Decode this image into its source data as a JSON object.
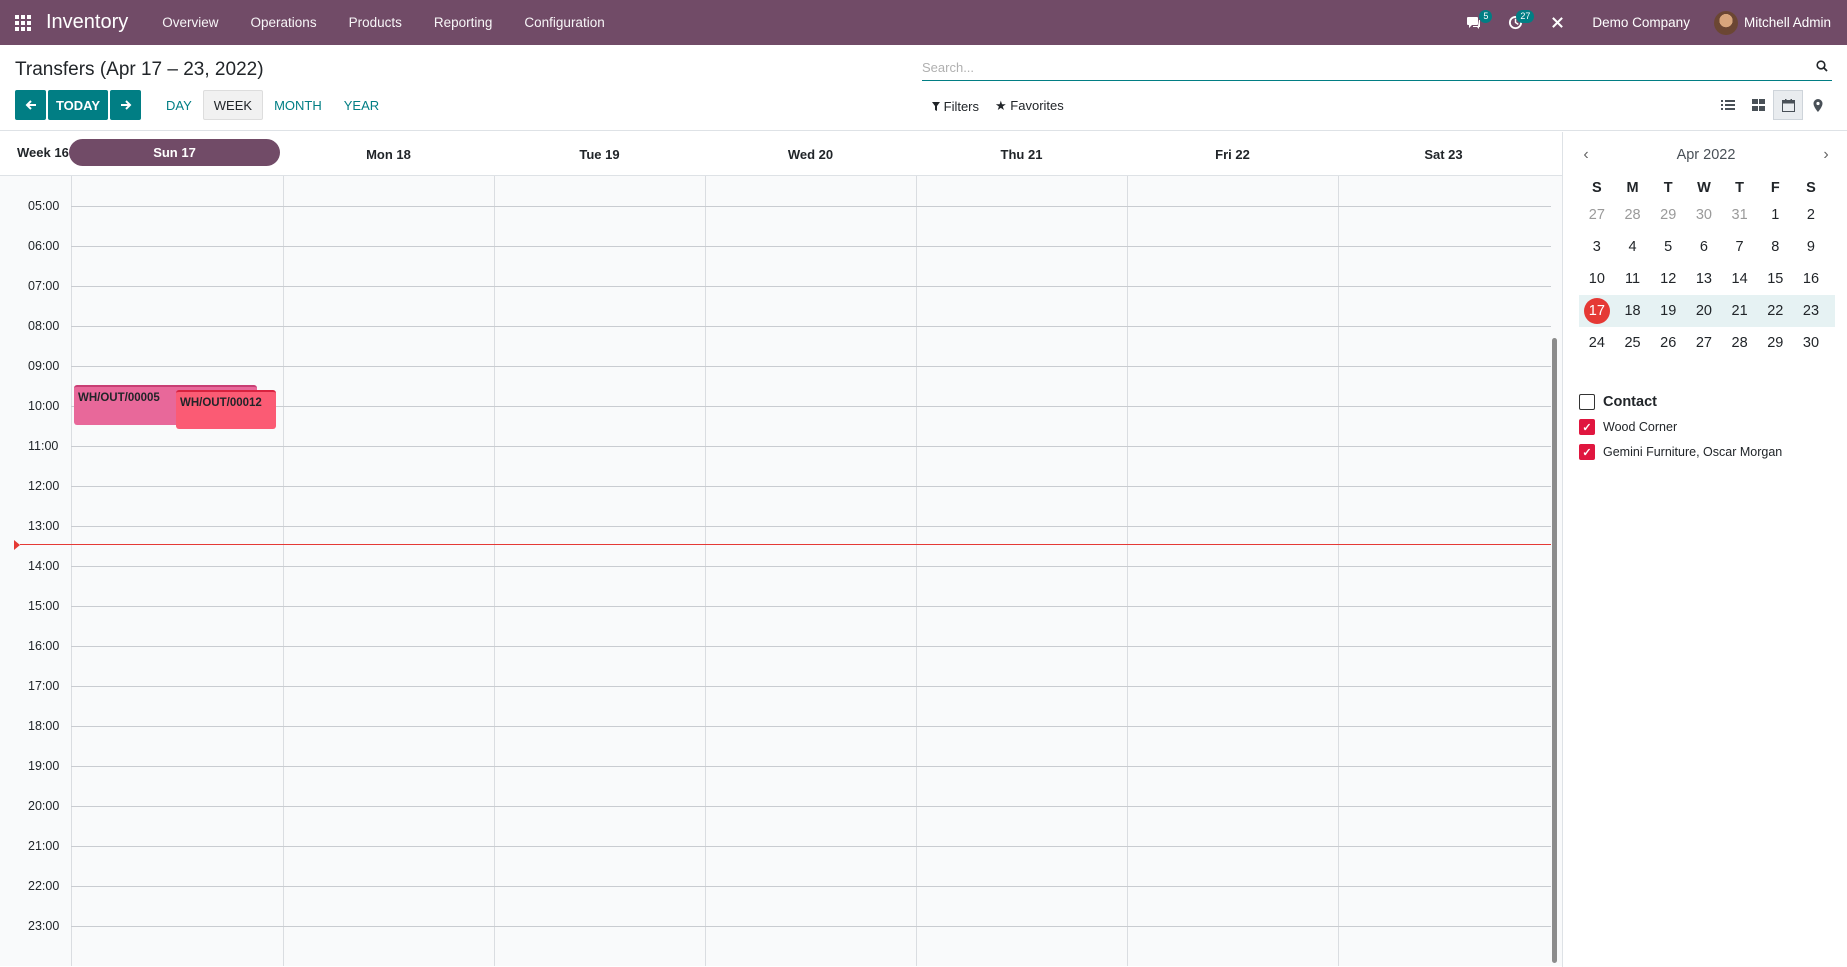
{
  "navbar": {
    "app_name": "Inventory",
    "menu": [
      "Overview",
      "Operations",
      "Products",
      "Reporting",
      "Configuration"
    ],
    "messages_badge": "5",
    "activities_badge": "27",
    "company": "Demo Company",
    "user": "Mitchell Admin"
  },
  "control": {
    "title": "Transfers (Apr 17 – 23, 2022)",
    "search_placeholder": "Search...",
    "today_label": "TODAY",
    "scales": [
      "DAY",
      "WEEK",
      "MONTH",
      "YEAR"
    ],
    "active_scale": "WEEK",
    "filters_label": "Filters",
    "favorites_label": "Favorites"
  },
  "calendar": {
    "week_label": "Week 16",
    "days": [
      "Sun 17",
      "Mon 18",
      "Tue 19",
      "Wed 20",
      "Thu 21",
      "Fri 22",
      "Sat 23"
    ],
    "hours": [
      "05:00",
      "06:00",
      "07:00",
      "08:00",
      "09:00",
      "10:00",
      "11:00",
      "12:00",
      "13:00",
      "14:00",
      "15:00",
      "16:00",
      "17:00",
      "18:00",
      "19:00",
      "20:00",
      "21:00",
      "22:00",
      "23:00"
    ],
    "events": [
      {
        "name": "WH/OUT/00005",
        "color": "#e8689a"
      },
      {
        "name": "WH/OUT/00012",
        "color": "#fb5b74"
      }
    ],
    "now_line_color": "#e53935"
  },
  "mini_calendar": {
    "month_label": "Apr 2022",
    "dow": [
      "S",
      "M",
      "T",
      "W",
      "T",
      "F",
      "S"
    ],
    "weeks": [
      [
        "27",
        "28",
        "29",
        "30",
        "31",
        "1",
        "2"
      ],
      [
        "3",
        "4",
        "5",
        "6",
        "7",
        "8",
        "9"
      ],
      [
        "10",
        "11",
        "12",
        "13",
        "14",
        "15",
        "16"
      ],
      [
        "17",
        "18",
        "19",
        "20",
        "21",
        "22",
        "23"
      ],
      [
        "24",
        "25",
        "26",
        "27",
        "28",
        "29",
        "30"
      ]
    ],
    "today": "17"
  },
  "filters": {
    "group_label": "Contact",
    "items": [
      {
        "label": "Wood Corner",
        "checked": true
      },
      {
        "label": "Gemini Furniture, Oscar Morgan",
        "checked": true
      }
    ]
  },
  "colors": {
    "brand": "#714b67",
    "primary": "#017e84",
    "today_red": "#e53935"
  }
}
